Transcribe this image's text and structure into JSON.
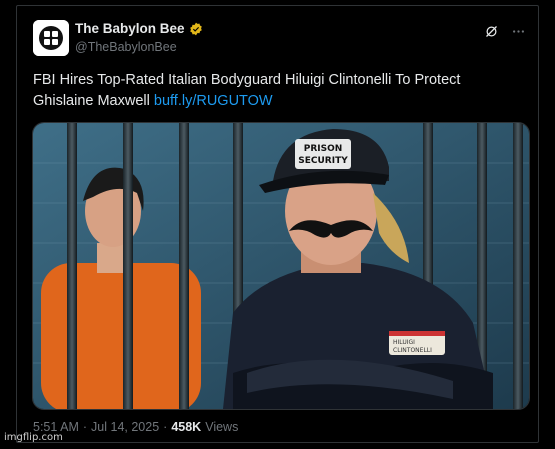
{
  "account": {
    "name": "The Babylon Bee",
    "handle": "@TheBabylonBee"
  },
  "tweet": {
    "text": "FBI Hires Top-Rated Italian Bodyguard Hiluigi Clintonelli To Protect Ghislaine Maxwell ",
    "link": "buff.ly/RUGUTOW"
  },
  "media": {
    "cap_text_line1": "PRISON",
    "cap_text_line2": "SECURITY",
    "badge_line1": "HILUIGI",
    "badge_line2": "CLINTONELLI"
  },
  "meta": {
    "time": "5:51 AM",
    "separator": "·",
    "date": "Jul 14, 2025",
    "views_count": "458K",
    "views_label": "Views"
  },
  "watermark": "imgflip.com",
  "colors": {
    "link": "#1d9bf0",
    "verified": "#e2b719",
    "text": "#e7e9ea",
    "muted": "#71767b"
  }
}
